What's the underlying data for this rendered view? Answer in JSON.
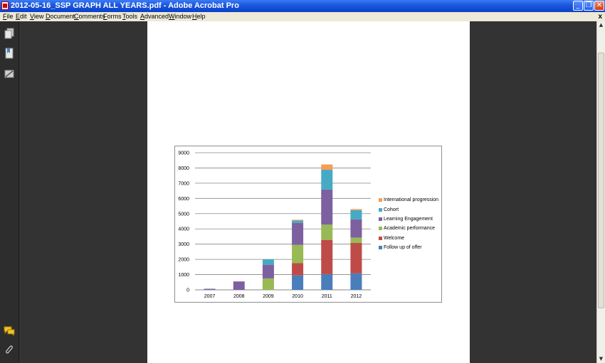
{
  "window": {
    "title": "2012-05-16_SSP GRAPH ALL YEARS.pdf - Adobe Acrobat Pro",
    "minimize": "_",
    "maximize": "❐",
    "close": "✕"
  },
  "menu": {
    "items": [
      "File",
      "Edit",
      "View",
      "Document",
      "Comments",
      "Forms",
      "Tools",
      "Advanced",
      "Window",
      "Help"
    ],
    "close_doc": "x"
  },
  "sidebar": {
    "icons": [
      "pages-icon",
      "bookmarks-icon",
      "signatures-icon"
    ],
    "bottom_icons": [
      "comments-icon",
      "attachments-icon"
    ]
  },
  "colors": {
    "follow_up": "#4a7ebb",
    "welcome": "#be4b48",
    "academic": "#98b954",
    "learning": "#7d60a0",
    "cohort": "#46aac5",
    "international": "#f59d56"
  },
  "chart_data": {
    "type": "bar",
    "stacked": true,
    "categories": [
      "2007",
      "2008",
      "2009",
      "2010",
      "2011",
      "2012"
    ],
    "ylim": [
      0,
      9000
    ],
    "yticks": [
      "9000",
      "8000",
      "7000",
      "6000",
      "5000",
      "4000",
      "3000",
      "2000",
      "1000",
      "0"
    ],
    "grid": true,
    "legend_position": "right",
    "series": [
      {
        "name": "Follow up of offer",
        "color": "#4a7ebb",
        "values": [
          0,
          0,
          0,
          950,
          1030,
          1080
        ]
      },
      {
        "name": "Welcome",
        "color": "#be4b48",
        "values": [
          0,
          0,
          0,
          800,
          2250,
          2000
        ]
      },
      {
        "name": "Academic performance",
        "color": "#98b954",
        "values": [
          0,
          0,
          750,
          1200,
          1000,
          350
        ]
      },
      {
        "name": "Learning Engagement",
        "color": "#7d60a0",
        "values": [
          70,
          550,
          900,
          1450,
          2300,
          1200
        ]
      },
      {
        "name": "Cohort",
        "color": "#46aac5",
        "values": [
          0,
          0,
          350,
          150,
          1300,
          600
        ]
      },
      {
        "name": "International progression",
        "color": "#f59d56",
        "values": [
          0,
          0,
          0,
          50,
          350,
          70
        ]
      }
    ],
    "legend_order": [
      "International progression",
      "Cohort",
      "Learning Engagement",
      "Academic performance",
      "Welcome",
      "Follow up of offer"
    ]
  }
}
